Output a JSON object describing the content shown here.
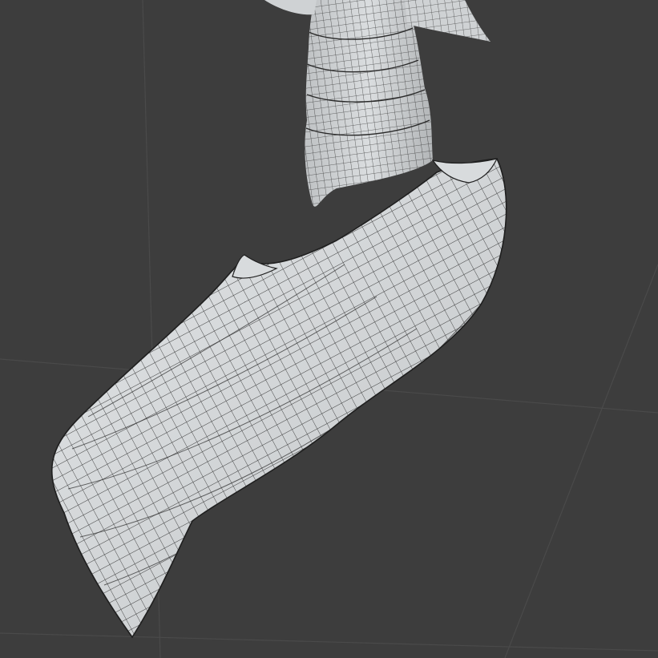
{
  "viewport": {
    "background_color": "#3d3d3d",
    "grid_color": "#4a4a4a",
    "mesh_fill_color": "#cfd2d4",
    "mesh_wire_color": "#2a2a2a",
    "object": "curved-blade-wireframe-mesh"
  }
}
